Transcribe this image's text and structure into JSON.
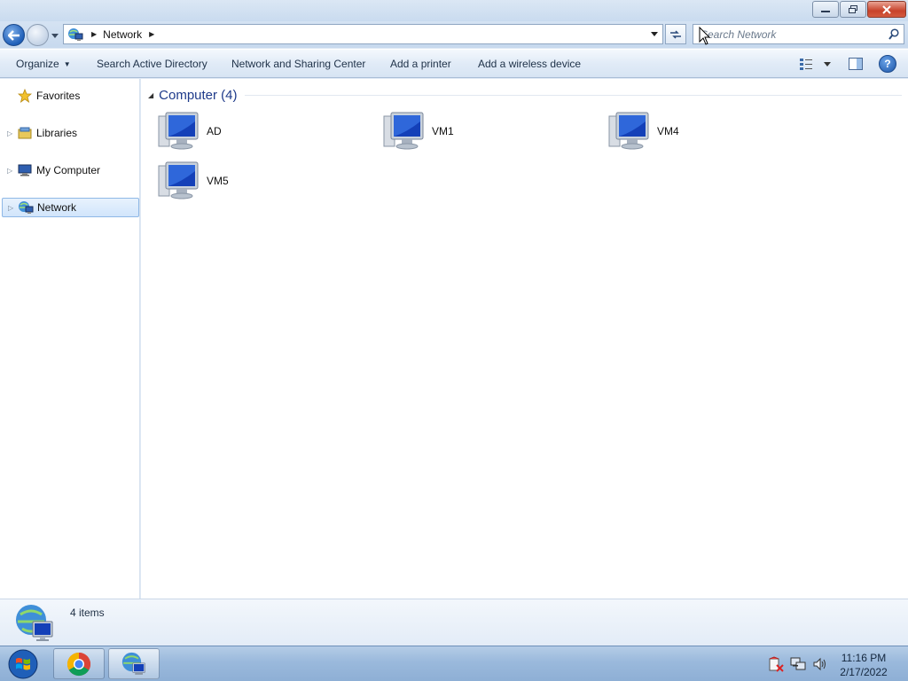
{
  "window": {
    "caption_buttons": [
      "minimize-icon",
      "restore-icon",
      "close-icon"
    ]
  },
  "address": {
    "breadcrumb": [
      "Network"
    ],
    "search_placeholder": "Search Network"
  },
  "toolbar": {
    "organize": "Organize",
    "search_ad": "Search Active Directory",
    "network_sharing": "Network and Sharing Center",
    "add_printer": "Add a printer",
    "add_wireless": "Add a wireless device"
  },
  "navpane": {
    "items": [
      {
        "label": "Favorites",
        "icon": "star-icon"
      },
      {
        "label": "Libraries",
        "icon": "libraries-icon"
      },
      {
        "label": "My Computer",
        "icon": "computer-icon"
      },
      {
        "label": "Network",
        "icon": "network-icon",
        "selected": true
      }
    ]
  },
  "content": {
    "group_title": "Computer (4)",
    "computers": [
      "AD",
      "VM1",
      "VM4",
      "VM5"
    ]
  },
  "details": {
    "item_count": "4 items"
  },
  "taskbar": {
    "time": "11:16 PM",
    "date": "2/17/2022"
  }
}
